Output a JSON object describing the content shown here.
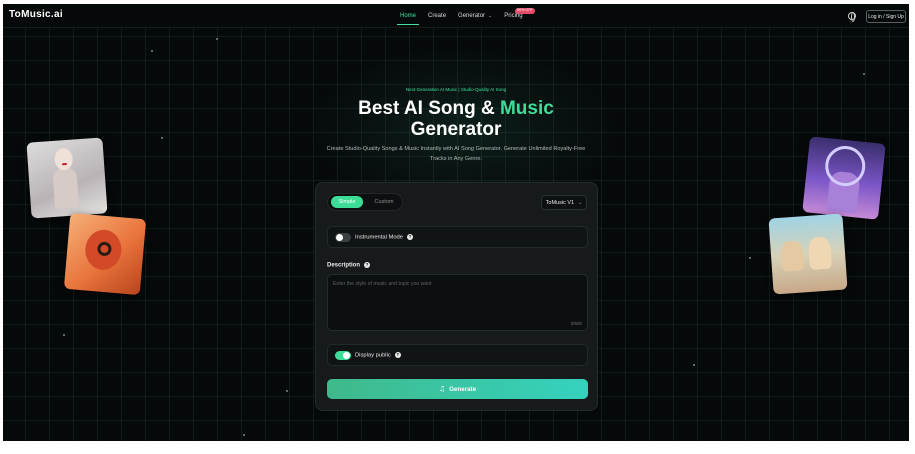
{
  "nav": {
    "logo": "ToMusic.ai",
    "links": [
      {
        "label": "Home",
        "active": true
      },
      {
        "label": "Create",
        "active": false
      },
      {
        "label": "Generator",
        "active": false,
        "has_dropdown": true
      },
      {
        "label": "Pricing",
        "active": false,
        "badge": "60% OFF"
      }
    ],
    "language_icon": "globe-icon",
    "login_label": "Log in / Sign Up"
  },
  "hero": {
    "tagline": "Next-Generation AI Music | Studio-Quality AI Song",
    "title_line1_white": "Best AI Song & ",
    "title_line1_accent": "Music",
    "title_line2": "Generator",
    "subtitle": "Create Studio-Quality Songs & Music Instantly with AI Song Generator. Generate Unlimited Royalty-Free Tracks in Any Genre."
  },
  "form": {
    "modes": [
      "Simple",
      "Custom"
    ],
    "active_mode": "Simple",
    "model": "ToMusic V1",
    "instrumental_label": "Instrumental Mode",
    "instrumental_on": false,
    "description_label": "Description",
    "description_placeholder": "Enter the style of music and topic you want",
    "description_value": "",
    "char_count": "0/500",
    "public_label": "Display public",
    "public_on": true,
    "generate_label": "Generate"
  },
  "colors": {
    "accent": "#3ddc97",
    "background": "#06090a",
    "panel": "#161a1a",
    "badge": "#e64b6a"
  }
}
